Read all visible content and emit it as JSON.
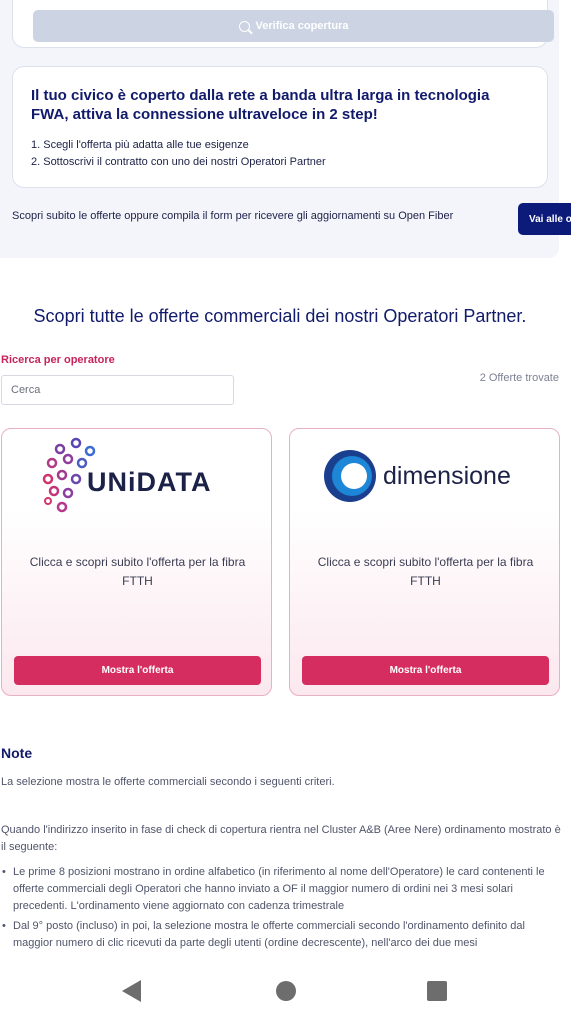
{
  "coverage": {
    "verify_button_label": "Verifica copertura",
    "info_title": "Il tuo civico è coperto dalla rete a banda ultra larga in tecnologia FWA, attiva la connessione ultraveloce in 2 step!",
    "steps": [
      "1. Scegli l'offerta più adatta alle tue esigenze",
      "2. Sottoscrivi il contratto con uno dei nostri Operatori Partner"
    ],
    "discover_text": "Scopri subito le offerte oppure compila il form per ricevere gli aggiornamenti su Open Fiber",
    "cta_label": "Vai alle offerte"
  },
  "offers": {
    "section_title": "Scopri tutte le offerte commerciali dei nostri Operatori Partner.",
    "search_label": "Ricerca per operatore",
    "search_placeholder": "Cerca",
    "found_count": "2 Offerte trovate",
    "cards": [
      {
        "operator": "UNiDATA",
        "description": "Clicca e scopri subito l'offerta per la fibra FTTH",
        "button_label": "Mostra l'offerta"
      },
      {
        "operator": "dimensione",
        "description": "Clicca e scopri subito l'offerta per la fibra FTTH",
        "button_label": "Mostra l'offerta"
      }
    ]
  },
  "notes": {
    "title": "Note",
    "intro": "La selezione mostra le offerte commerciali secondo i seguenti criteri.",
    "condition": "Quando l'indirizzo inserito in fase di check di copertura rientra nel Cluster A&B (Aree Nere) ordinamento mostrato è il seguente:",
    "bullets": [
      "Le prime 8 posizioni mostrano in ordine alfabetico (in riferimento al nome dell'Operatore) le card contenenti le offerte commerciali degli Operatori che hanno inviato a OF il maggior numero di ordini nei 3 mesi solari precedenti. L'ordinamento viene aggiornato con cadenza trimestrale",
      "Dal 9° posto (incluso) in poi, la selezione mostra le offerte commerciali secondo l'ordinamento definito dal maggior numero di clic ricevuti da parte degli utenti (ordine decrescente), nell'arco dei due mesi"
    ]
  },
  "colors": {
    "brand_navy": "#111a6b",
    "accent_pink": "#d62d60",
    "cta_navy": "#0c1a7a",
    "disabled_button": "#ccd3e2"
  }
}
